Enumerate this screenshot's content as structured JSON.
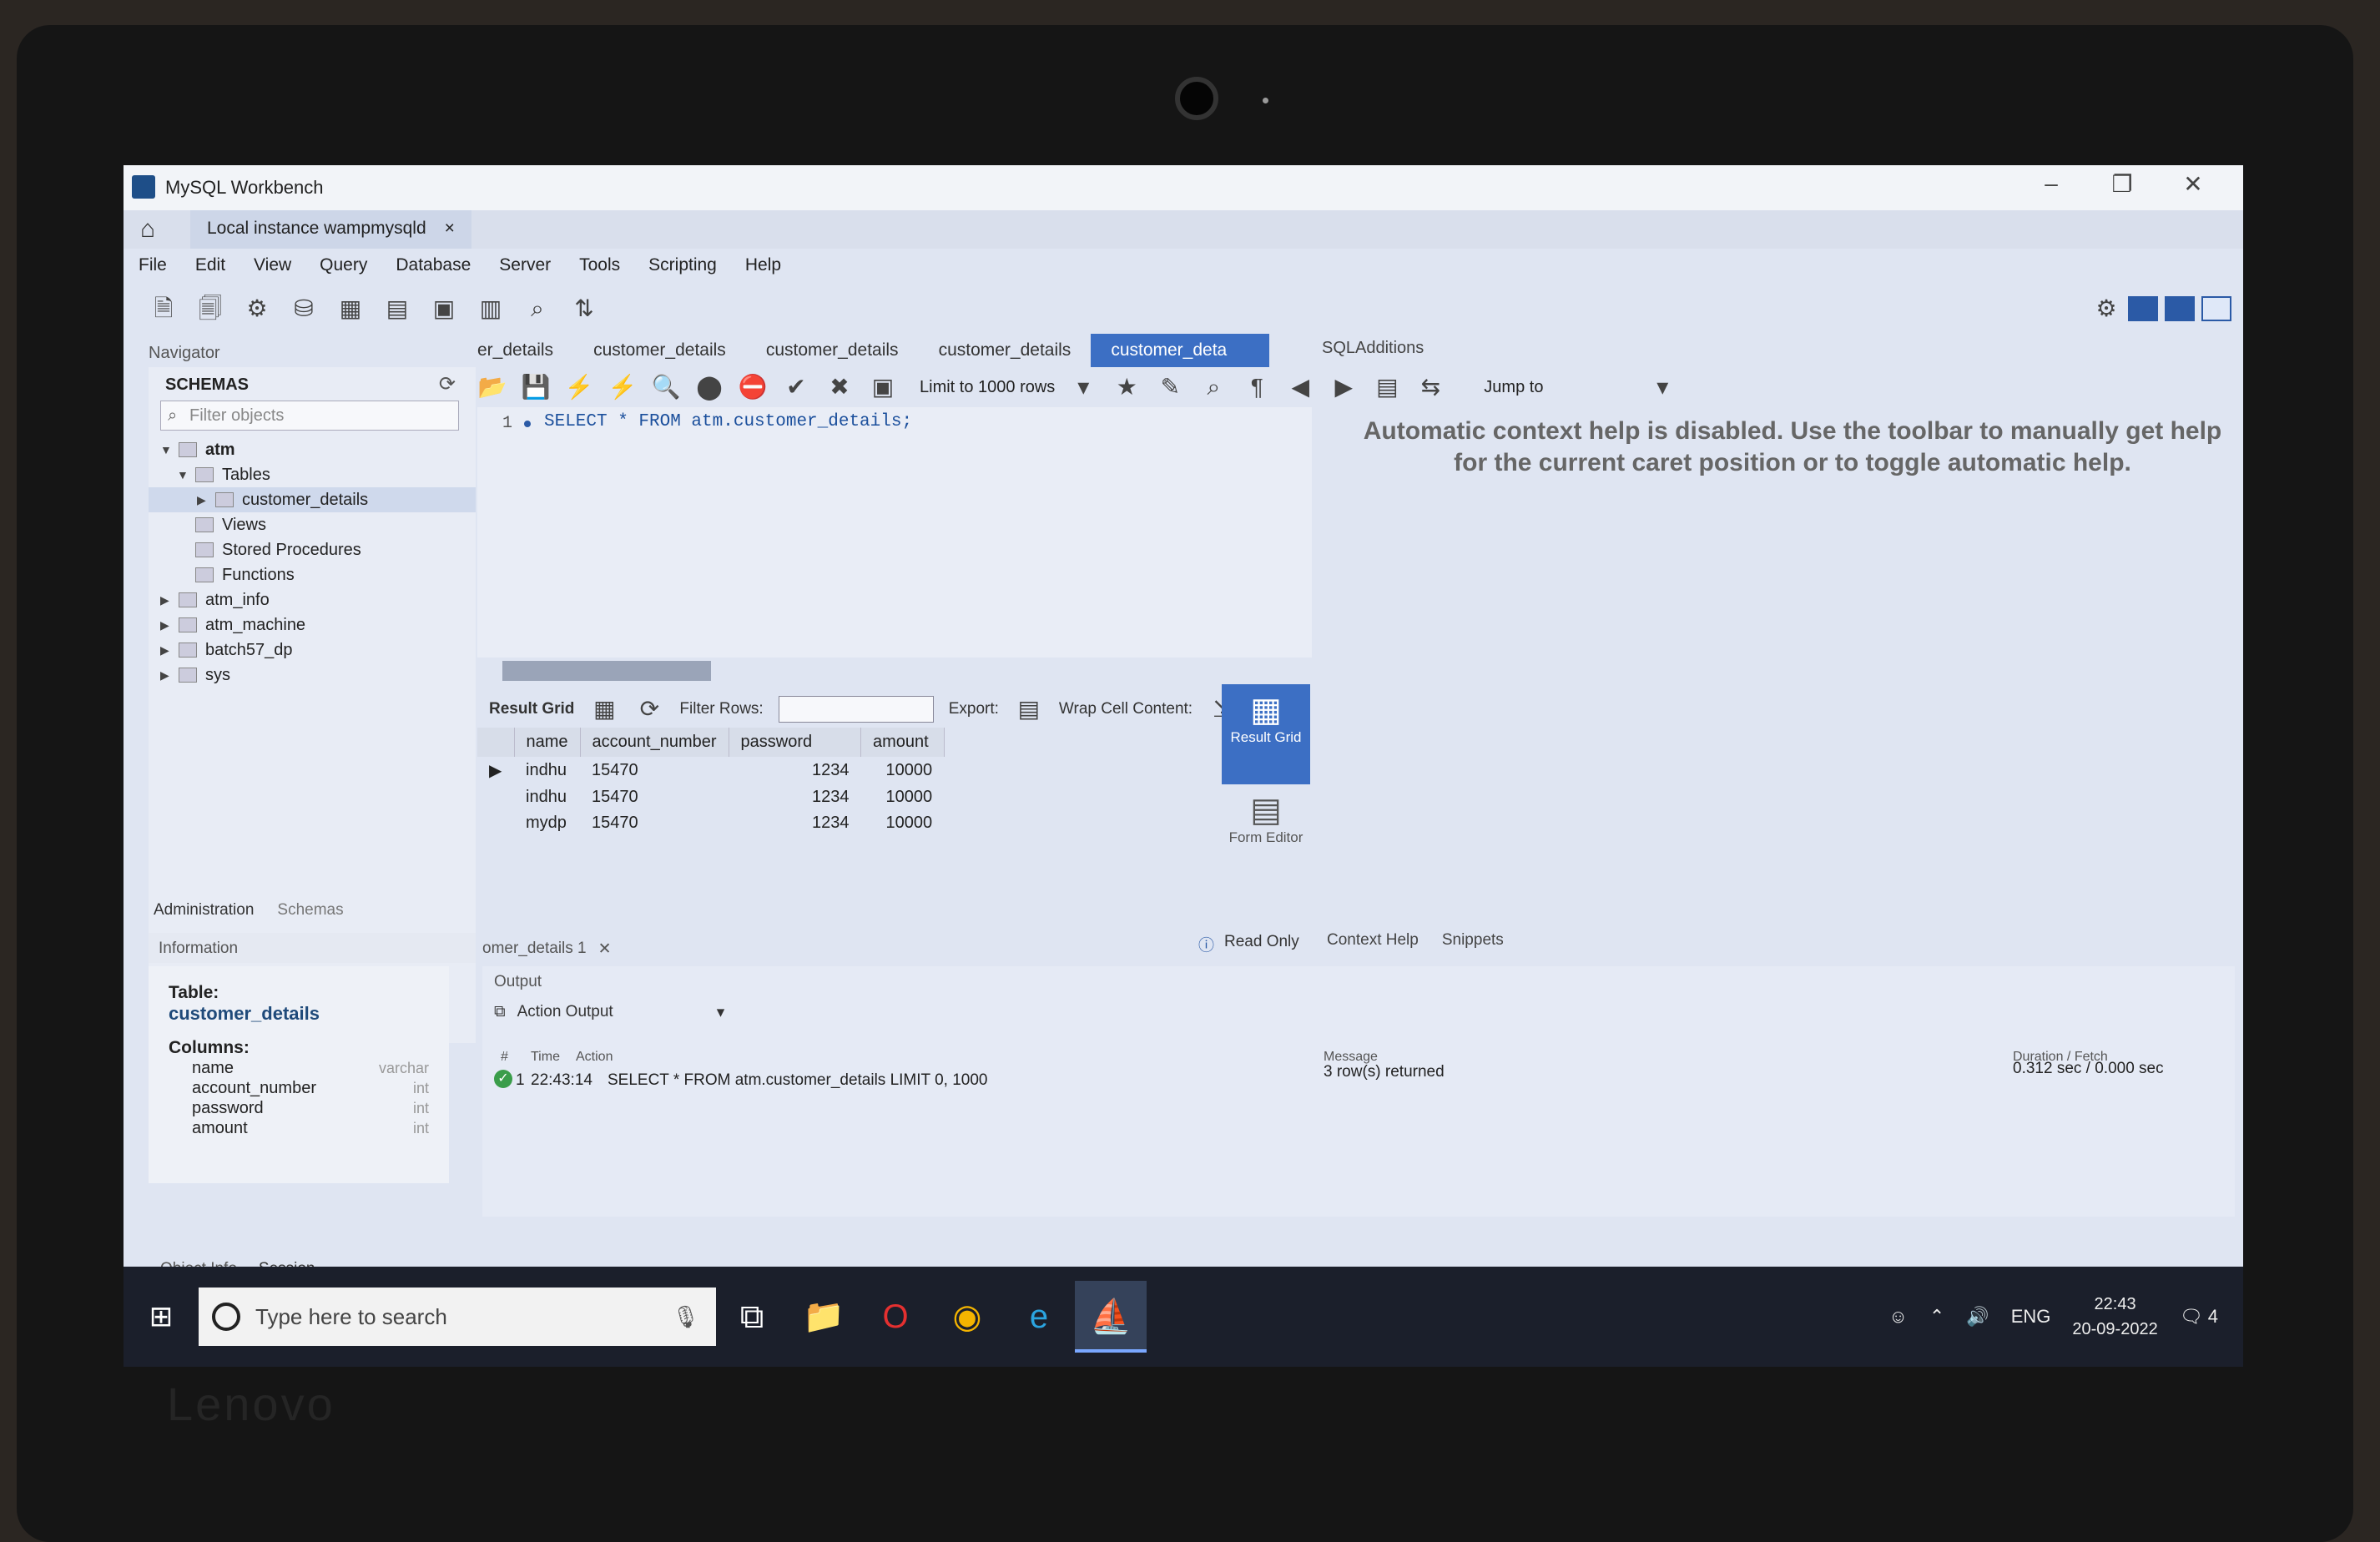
{
  "window": {
    "title": "MySQL Workbench",
    "minimize": "–",
    "restore": "❐",
    "close": "✕"
  },
  "connection_tab": {
    "label": "Local instance wampmysqld",
    "close": "×"
  },
  "menu": [
    "File",
    "Edit",
    "View",
    "Query",
    "Database",
    "Server",
    "Tools",
    "Scripting",
    "Help"
  ],
  "navigator": {
    "header": "Navigator",
    "schemas_title": "SCHEMAS",
    "filter_placeholder": "Filter objects",
    "tree": {
      "atm": "atm",
      "tables": "Tables",
      "customer_details": "customer_details",
      "views": "Views",
      "stored_procedures": "Stored Procedures",
      "functions": "Functions",
      "atm_info": "atm_info",
      "atm_machine": "atm_machine",
      "batch57_dp": "batch57_dp",
      "sys": "sys"
    },
    "bottom_tabs": [
      "Administration",
      "Schemas"
    ]
  },
  "info": {
    "header": "Information",
    "table_label": "Table:",
    "table_name": "customer_details",
    "columns_label": "Columns:",
    "columns": [
      {
        "name": "name",
        "type": "varchar"
      },
      {
        "name": "account_number",
        "type": "int"
      },
      {
        "name": "password",
        "type": "int"
      },
      {
        "name": "amount",
        "type": "int"
      }
    ],
    "footer_tabs": [
      "Object Info",
      "Session"
    ]
  },
  "query_tabs": [
    "er_details",
    "customer_details",
    "customer_details",
    "customer_details",
    "customer_deta"
  ],
  "sql_additions": "SQLAdditions",
  "editor_toolbar": {
    "limit": "Limit to 1000 rows",
    "jump_to": "Jump to"
  },
  "editor": {
    "line_number": "1",
    "sql": "SELECT * FROM atm.customer_details;"
  },
  "context_help": "Automatic context help is disabled. Use the toolbar to manually get help for the current caret position or to toggle automatic help.",
  "result_toolbar": {
    "result_grid": "Result Grid",
    "filter_rows": "Filter Rows:",
    "export": "Export:",
    "wrap": "Wrap Cell Content:"
  },
  "result_grid": {
    "columns": [
      "name",
      "account_number",
      "password",
      "amount"
    ],
    "rows": [
      [
        "indhu",
        "15470",
        "1234",
        "10000"
      ],
      [
        "indhu",
        "15470",
        "1234",
        "10000"
      ],
      [
        "mydp",
        "15470",
        "1234",
        "10000"
      ]
    ]
  },
  "side_panel": {
    "result_grid": "Result Grid",
    "form_editor": "Form Editor"
  },
  "read_only": "Read Only",
  "context_tabs": [
    "Context Help",
    "Snippets"
  ],
  "output_tab": "omer_details 1",
  "output": {
    "label": "Output",
    "action_output": "Action Output",
    "headers": {
      "num": "#",
      "time": "Time",
      "action": "Action",
      "message": "Message",
      "duration": "Duration / Fetch"
    },
    "row": {
      "num": "1",
      "time": "22:43:14",
      "action": "SELECT * FROM atm.customer_details LIMIT 0, 1000",
      "message": "3 row(s) returned",
      "duration": "0.312 sec / 0.000 sec"
    }
  },
  "taskbar": {
    "search_placeholder": "Type here to search",
    "lang": "ENG",
    "time": "22:43",
    "date": "20-09-2022",
    "notifications": "4"
  },
  "bezel_brand": "Lenovo"
}
